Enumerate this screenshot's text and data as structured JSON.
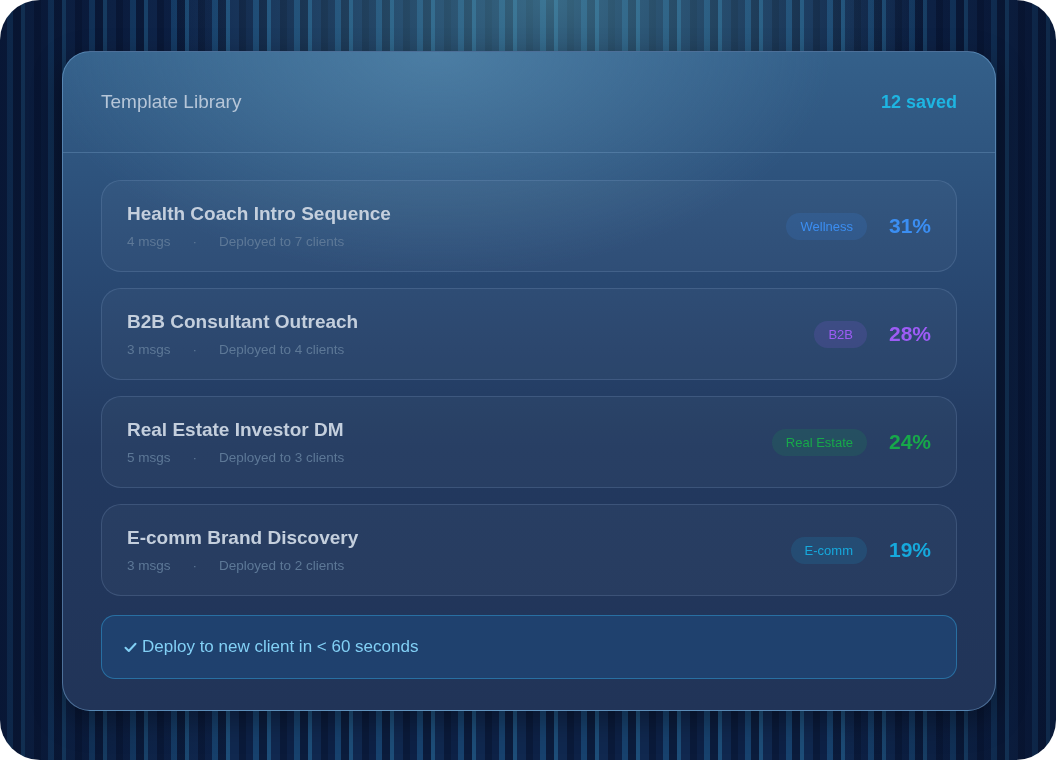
{
  "header": {
    "title": "Template Library",
    "saved_count": "12 saved"
  },
  "templates": [
    {
      "name": "Health Coach Intro Sequence",
      "messages": "4 msgs",
      "separator": "·",
      "deployed": "Deployed to 7 clients",
      "tag": "Wellness",
      "rate": "31%",
      "color": "#3b8ef2"
    },
    {
      "name": "B2B Consultant Outreach",
      "messages": "3 msgs",
      "separator": "·",
      "deployed": "Deployed to 4 clients",
      "tag": "B2B",
      "rate": "28%",
      "color": "#9d5cf5"
    },
    {
      "name": "Real Estate Investor DM",
      "messages": "5 msgs",
      "separator": "·",
      "deployed": "Deployed to 3 clients",
      "tag": "Real Estate",
      "rate": "24%",
      "color": "#17a84a"
    },
    {
      "name": "E-comm Brand Discovery",
      "messages": "3 msgs",
      "separator": "·",
      "deployed": "Deployed to 2 clients",
      "tag": "E-comm",
      "rate": "19%",
      "color": "#16a9dc"
    }
  ],
  "footer_note": {
    "text": "Deploy to new client in < 60 seconds"
  }
}
